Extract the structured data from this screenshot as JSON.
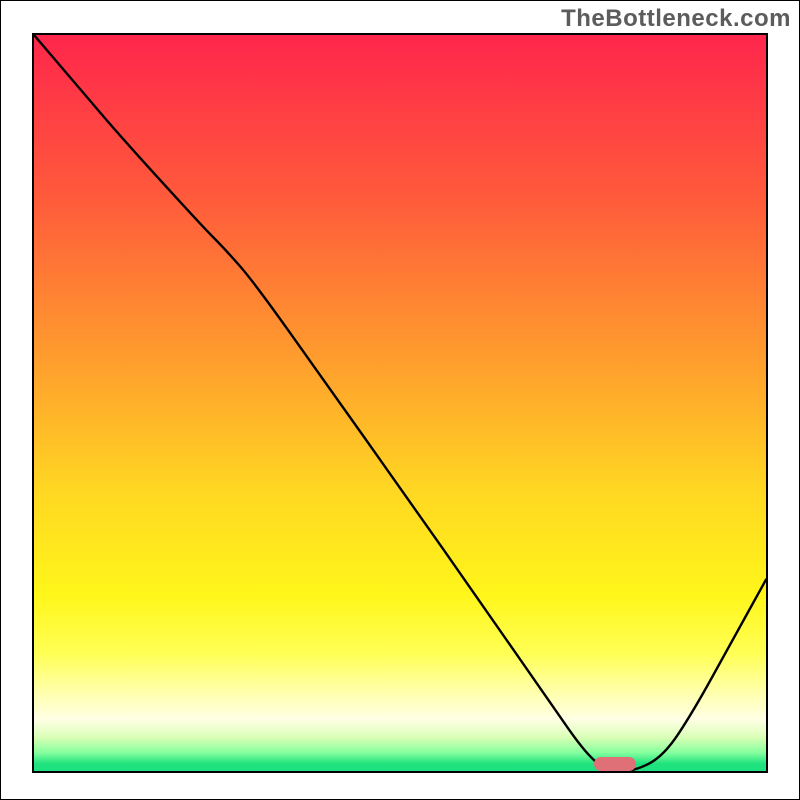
{
  "watermark": "TheBottleneck.com",
  "chart_data": {
    "type": "line",
    "title": "",
    "xlabel": "",
    "ylabel": "",
    "xlim": [
      0,
      100
    ],
    "ylim": [
      0,
      100
    ],
    "series": [
      {
        "name": "bottleneck-curve",
        "x": [
          0,
          6,
          12,
          23,
          26,
          30,
          40,
          50,
          62,
          70,
          76,
          79,
          82,
          86,
          90,
          95,
          100
        ],
        "y": [
          100,
          93,
          86,
          74,
          71,
          66.5,
          52.5,
          38.5,
          21.5,
          10,
          1.5,
          0,
          0,
          2,
          8,
          17,
          26
        ]
      }
    ],
    "marker": {
      "name": "optimal-range",
      "x_range": [
        76.5,
        82.2
      ],
      "y": 0.9,
      "color": "#e07078"
    },
    "gradient_stops": [
      {
        "offset": 0.0,
        "color": "#ff264c"
      },
      {
        "offset": 0.22,
        "color": "#ff5a3b"
      },
      {
        "offset": 0.45,
        "color": "#ffa02d"
      },
      {
        "offset": 0.62,
        "color": "#ffd722"
      },
      {
        "offset": 0.76,
        "color": "#fff61a"
      },
      {
        "offset": 0.84,
        "color": "#ffff55"
      },
      {
        "offset": 0.89,
        "color": "#ffffa8"
      },
      {
        "offset": 0.93,
        "color": "#ffffe5"
      },
      {
        "offset": 0.955,
        "color": "#d8ffb5"
      },
      {
        "offset": 0.975,
        "color": "#86ff9e"
      },
      {
        "offset": 0.99,
        "color": "#20e37e"
      },
      {
        "offset": 1.0,
        "color": "#1de080"
      }
    ]
  }
}
